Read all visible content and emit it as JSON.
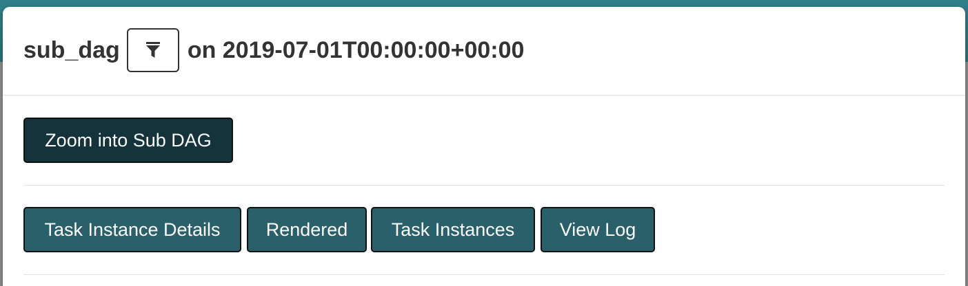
{
  "modal": {
    "task_id": "sub_dag",
    "title_suffix": "on 2019-07-01T00:00:00+00:00",
    "filter_icon": "filter-icon"
  },
  "actions": {
    "zoom_label": "Zoom into Sub DAG",
    "buttons": [
      {
        "label": "Task Instance Details"
      },
      {
        "label": "Rendered"
      },
      {
        "label": "Task Instances"
      },
      {
        "label": "View Log"
      }
    ]
  },
  "colors": {
    "dark_button": "#14333a",
    "teal_button": "#29606a",
    "title_text": "#333333"
  }
}
